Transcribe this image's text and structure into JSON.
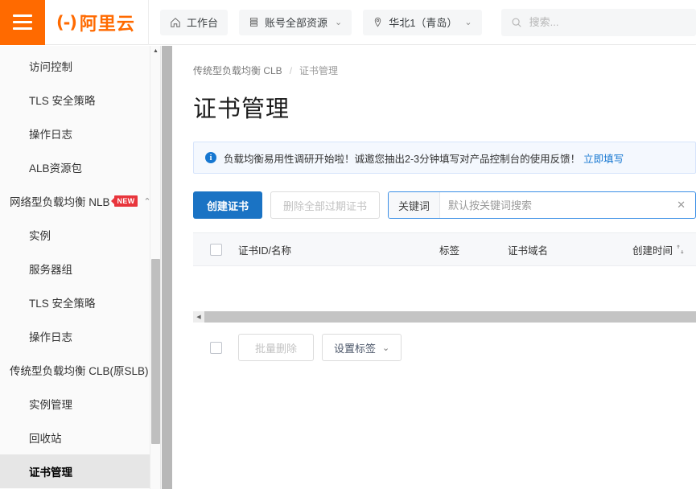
{
  "header": {
    "menu_icon": "hamburger-icon",
    "logo_mark": "(-)",
    "logo_text": "阿里云",
    "workbench": {
      "label": "工作台",
      "icon": "home-icon"
    },
    "resources": {
      "label": "账号全部资源",
      "icon": "resource-icon",
      "caret": "⌄"
    },
    "region": {
      "label": "华北1（青岛）",
      "icon": "location-icon",
      "caret": "⌄"
    },
    "search": {
      "placeholder": "搜索...",
      "value": "",
      "icon": "search-icon"
    }
  },
  "sidebar": {
    "items": [
      {
        "label": "访问控制",
        "type": "item",
        "active": false
      },
      {
        "label": "TLS 安全策略",
        "type": "item",
        "active": false
      },
      {
        "label": "操作日志",
        "type": "item",
        "active": false
      },
      {
        "label": "ALB资源包",
        "type": "item",
        "active": false
      },
      {
        "label": "网络型负载均衡 NLB",
        "type": "group",
        "badge": "NEW",
        "arrow": "⌃"
      },
      {
        "label": "实例",
        "type": "item",
        "active": false
      },
      {
        "label": "服务器组",
        "type": "item",
        "active": false
      },
      {
        "label": "TLS 安全策略",
        "type": "item",
        "active": false
      },
      {
        "label": "操作日志",
        "type": "item",
        "active": false
      },
      {
        "label": "传统型负载均衡 CLB(原SLB)",
        "type": "group",
        "arrow": "⌃"
      },
      {
        "label": "实例管理",
        "type": "item",
        "active": false
      },
      {
        "label": "回收站",
        "type": "item",
        "active": false
      },
      {
        "label": "证书管理",
        "type": "item",
        "active": true
      }
    ],
    "collapse_handle": "‹",
    "scroll_up": "▲"
  },
  "main": {
    "breadcrumb": {
      "parent": "传统型负载均衡 CLB",
      "separator": "/",
      "current": "证书管理"
    },
    "title": "证书管理",
    "notice": {
      "icon": "info-icon",
      "glyph": "i",
      "text": "负载均衡易用性调研开始啦！诚邀您抽出2-3分钟填写对产品控制台的使用反馈！",
      "link": "立即填写"
    },
    "toolbar": {
      "create_label": "创建证书",
      "delete_expired_label": "删除全部过期证书",
      "search_prefix": "关键词",
      "search_placeholder": "默认按关键词搜索",
      "search_value": "",
      "clear_icon": "✕"
    },
    "table": {
      "columns": [
        "证书ID/名称",
        "标签",
        "证书域名",
        "创建时间"
      ],
      "sort_icon": "sort-icon",
      "rows": []
    },
    "hscroll_arrow": "◀",
    "batch": {
      "delete_label": "批量删除",
      "tag_label": "设置标签",
      "caret": "⌄"
    }
  },
  "colors": {
    "brand_orange": "#FF6A00",
    "primary_blue": "#1A73C4",
    "badge_red": "#E8353C",
    "notice_bg": "#F4F8FE"
  }
}
